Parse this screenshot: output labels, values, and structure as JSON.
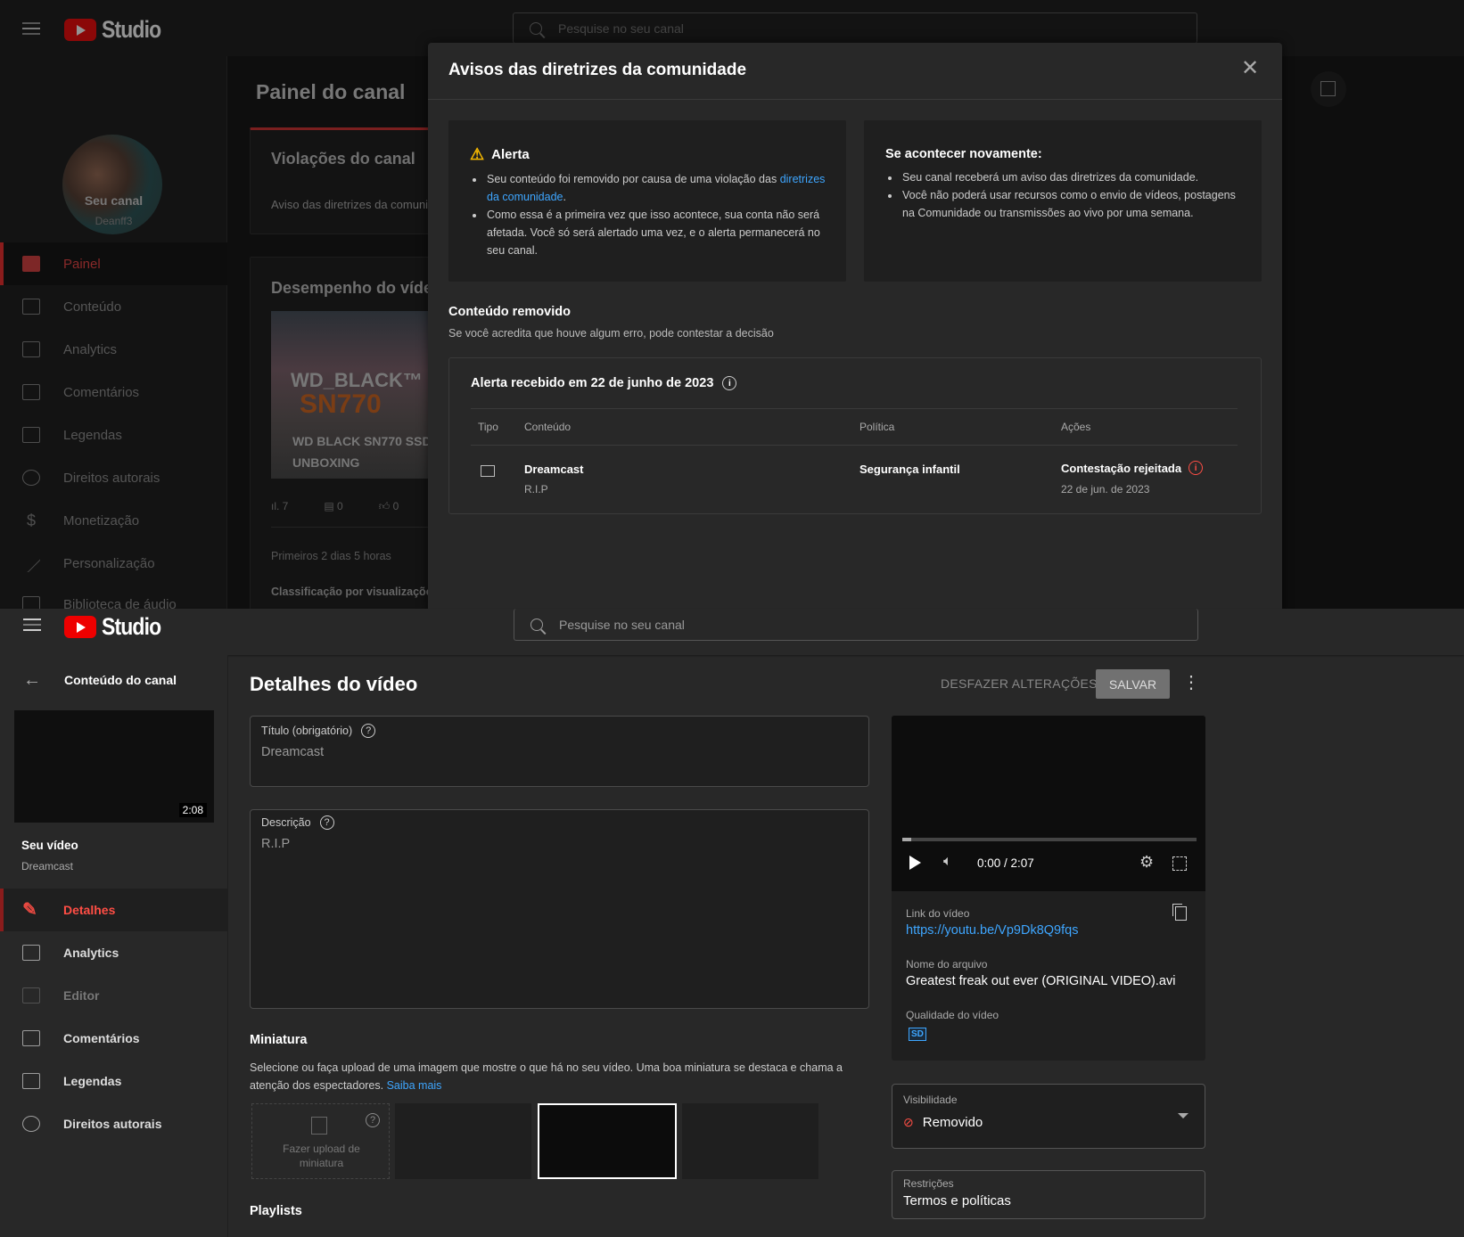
{
  "top": {
    "header": {
      "logo_text": "Studio",
      "search_placeholder": "Pesquise no seu canal"
    },
    "sidebar": {
      "channel_label": "Seu canal",
      "channel_handle": "Deanff3",
      "items": [
        {
          "label": "Painel",
          "icon": "dashboard-icon",
          "active": true
        },
        {
          "label": "Conteúdo",
          "icon": "content-icon"
        },
        {
          "label": "Analytics",
          "icon": "analytics-icon"
        },
        {
          "label": "Comentários",
          "icon": "comments-icon"
        },
        {
          "label": "Legendas",
          "icon": "subtitles-icon"
        },
        {
          "label": "Direitos autorais",
          "icon": "copyright-icon"
        },
        {
          "label": "Monetização",
          "icon": "dollar-icon"
        },
        {
          "label": "Personalização",
          "icon": "magic-wand-icon"
        },
        {
          "label": "Biblioteca de áudio",
          "icon": "audio-library-icon"
        }
      ]
    },
    "main": {
      "title": "Painel do canal",
      "violations": {
        "title": "Violações do canal",
        "text": "Aviso das diretrizes da comuni"
      },
      "performance": {
        "title": "Desempenho do víde",
        "thumb_line1": "WD_BLACK™",
        "thumb_line2": "SN770",
        "thumb_caption1": "WD BLACK SN770 SSD",
        "thumb_caption2": "UNBOXING",
        "views": "7",
        "comments": "0",
        "likes": "0",
        "period": "Primeiros 2 dias 5 horas",
        "ranking": "Classificação por visualizaçõe"
      }
    },
    "modal": {
      "title": "Avisos das diretrizes da comunidade",
      "alert": {
        "title": "Alerta",
        "bullet1_pre": "Seu conteúdo foi removido por causa de uma violação das ",
        "bullet1_link": "diretrizes da comunidade",
        "bullet1_post": ".",
        "bullet2": "Como essa é a primeira vez que isso acontece, sua conta não será afetada. Você só será alertado uma vez, e o alerta permanecerá no seu canal."
      },
      "again": {
        "title": "Se acontecer novamente:",
        "bullet1": "Seu canal receberá um aviso das diretrizes da comunidade.",
        "bullet2": "Você não poderá usar recursos como o envio de vídeos, postagens na Comunidade ou transmissões ao vivo por uma semana."
      },
      "removed": {
        "title": "Conteúdo removido",
        "subtitle": "Se você acredita que houve algum erro, pode contestar a decisão"
      },
      "table": {
        "title": "Alerta recebido em 22 de junho de 2023",
        "headers": [
          "Tipo",
          "Conteúdo",
          "Política",
          "Ações"
        ],
        "row": {
          "content_title": "Dreamcast",
          "content_desc": "R.I.P",
          "policy": "Segurança infantil",
          "action": "Contestação rejeitada",
          "action_date": "22 de jun. de 2023"
        }
      }
    }
  },
  "bottom": {
    "header": {
      "logo_text": "Studio",
      "search_placeholder": "Pesquise no seu canal"
    },
    "sidebar": {
      "back_label": "Conteúdo do canal",
      "duration": "2:08",
      "video_label": "Seu vídeo",
      "video_title": "Dreamcast",
      "items": [
        {
          "label": "Detalhes",
          "active": true
        },
        {
          "label": "Analytics"
        },
        {
          "label": "Editor"
        },
        {
          "label": "Comentários"
        },
        {
          "label": "Legendas"
        },
        {
          "label": "Direitos autorais"
        }
      ]
    },
    "main": {
      "title": "Detalhes do vídeo",
      "undo_label": "DESFAZER ALTERAÇÕES",
      "save_label": "SALVAR",
      "title_field": {
        "label": "Título (obrigatório)",
        "value": "Dreamcast"
      },
      "description_field": {
        "label": "Descrição",
        "value": "R.I.P"
      },
      "thumbnail": {
        "title": "Miniatura",
        "text": "Selecione ou faça upload de uma imagem que mostre o que há no seu vídeo. Uma boa miniatura se destaca e chama a atenção dos espectadores.",
        "link": "Saiba mais",
        "upload_label": "Fazer upload de miniatura"
      },
      "playlists": {
        "title": "Playlists"
      }
    },
    "panel": {
      "time": "0:00 / 2:07",
      "progress": 0.03,
      "link_label": "Link do vídeo",
      "link": "https://youtu.be/Vp9Dk8Q9fqs",
      "filename_label": "Nome do arquivo",
      "filename": "Greatest freak out ever (ORIGINAL VIDEO).avi",
      "quality_label": "Qualidade do vídeo",
      "quality": "SD",
      "visibility_label": "Visibilidade",
      "visibility": "Removido",
      "restrictions_label": "Restrições",
      "restrictions": "Termos e políticas"
    }
  },
  "colors": {
    "accent_red": "#ff4e45",
    "link_blue": "#3ea6ff",
    "warning_yellow": "#f5b800"
  }
}
